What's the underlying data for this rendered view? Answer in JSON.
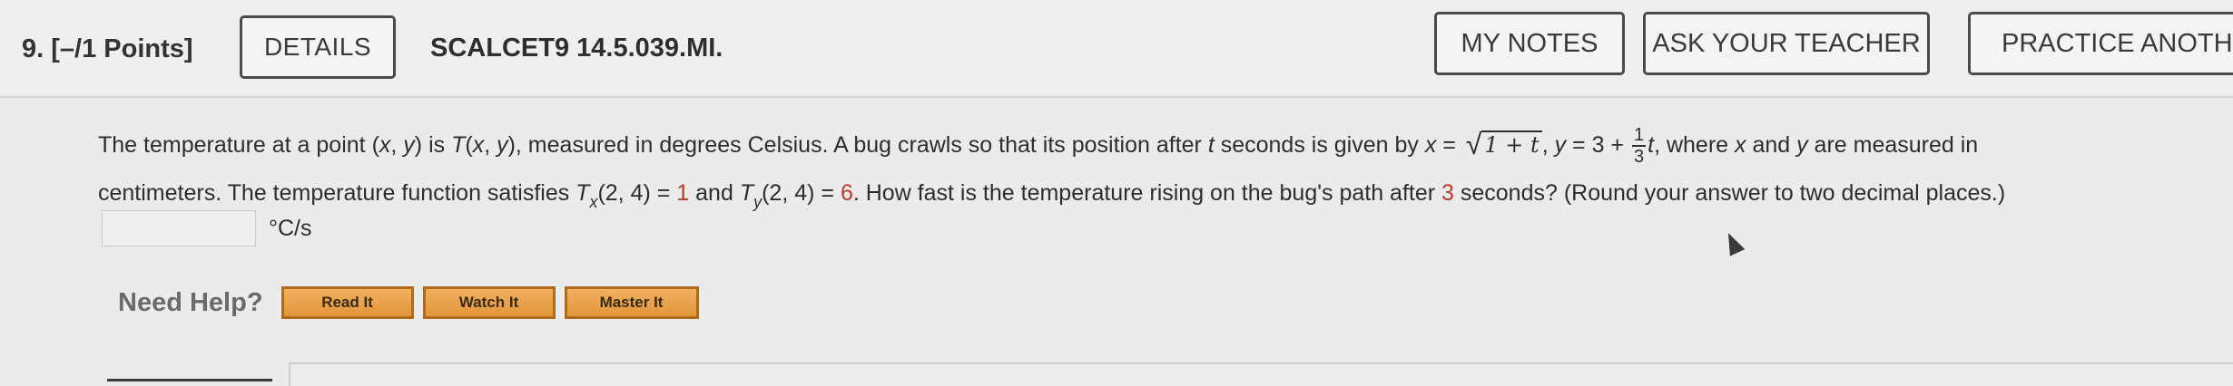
{
  "header": {
    "question_label": "9.  [–/1 Points]",
    "details_label": "DETAILS",
    "code": "SCALCET9 14.5.039.MI.",
    "my_notes_label": "MY NOTES",
    "ask_teacher_label": "ASK YOUR TEACHER",
    "practice_label": "PRACTICE ANOTHE"
  },
  "question": {
    "line1_a": "The temperature at a point (",
    "x": "x",
    "comma_space": ", ",
    "y": "y",
    "line1_b": ") is ",
    "T": "T",
    "line1_c": "(",
    "line1_d": "), measured in degrees Celsius. A bug crawls so that its position after ",
    "t": "t",
    "line1_e": " seconds is given by ",
    "eq_x": "x",
    "eq1": " = ",
    "sqrt_body": "1 + t",
    "line1_f": ", ",
    "eq_y": "y",
    "eq2": " = 3 + ",
    "frac_num": "1",
    "frac_den": "3",
    "eq_t": "t",
    "line1_g": ", where ",
    "line1_h": " and ",
    "line1_i": " are measured in",
    "line2_a": "centimeters. The temperature function satisfies ",
    "Tx_sub": "x",
    "Tx_args": "(2, 4) = ",
    "Tx_val": "1",
    "line2_b": " and ",
    "Ty_sub": "y",
    "Ty_args": "(2, 4) = ",
    "Ty_val": "6",
    "line2_c": ". How fast is the temperature rising on the bug's path after ",
    "seconds_val": "3",
    "line2_d": " seconds? (Round your answer to two decimal places.)"
  },
  "answer": {
    "value": "",
    "unit": "°C/s"
  },
  "help": {
    "need_help_label": "Need Help?",
    "read_it_label": "Read It",
    "watch_it_label": "Watch It",
    "master_it_label": "Master It"
  },
  "colors": {
    "accent_red": "#c0392b",
    "help_button": "#e3963a"
  }
}
